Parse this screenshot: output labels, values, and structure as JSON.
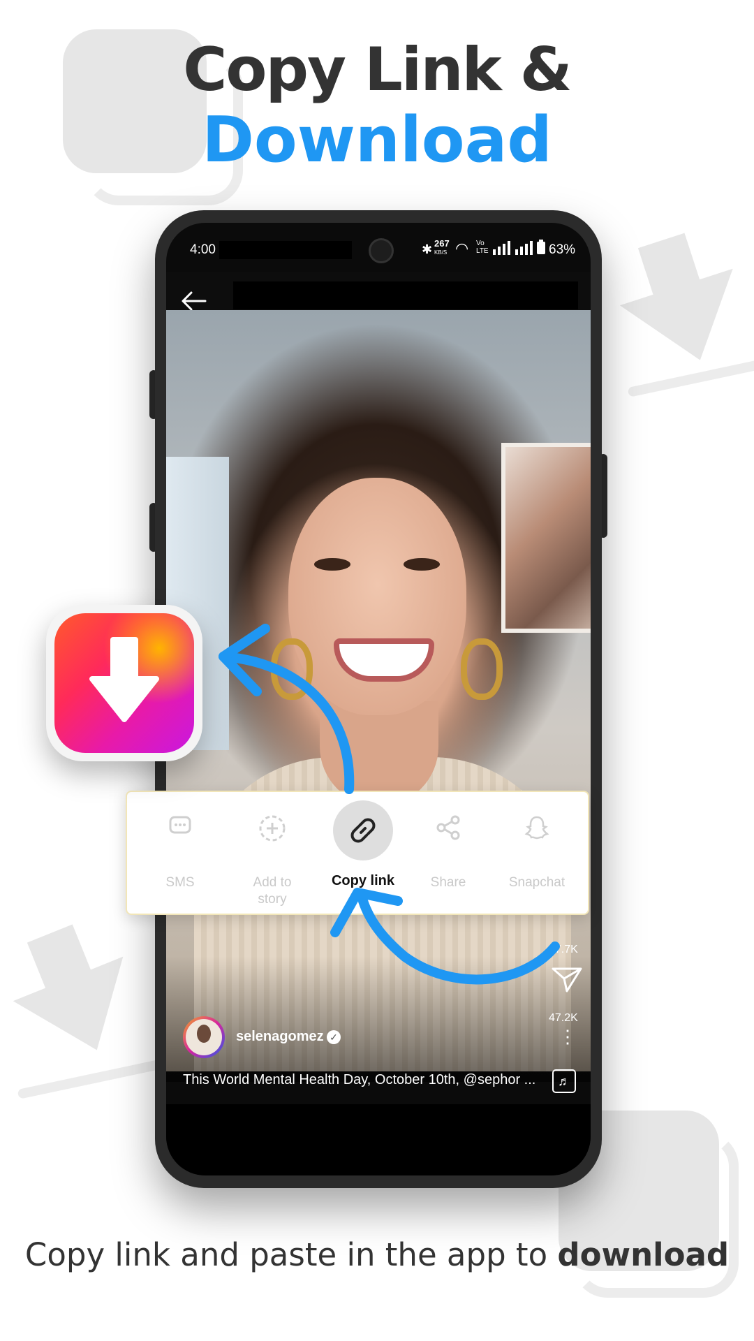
{
  "headline": {
    "line1": "Copy Link &",
    "line2": "Download"
  },
  "status_bar": {
    "time": "4:00",
    "net_speed": "267",
    "net_speed_unit": "KB/S",
    "battery": "63%"
  },
  "post": {
    "username": "selenagomez",
    "caption": "This World Mental Health Day, October 10th, @sephor ...",
    "likes_count": "27.7K",
    "shares_count": "47.2K"
  },
  "share_sheet": {
    "items": [
      {
        "label": "SMS",
        "icon": "sms-icon"
      },
      {
        "label": "Add to story",
        "icon": "add-story-icon"
      },
      {
        "label": "Copy link",
        "icon": "link-icon"
      },
      {
        "label": "Share",
        "icon": "share-icon"
      },
      {
        "label": "Snapchat",
        "icon": "snapchat-icon"
      }
    ]
  },
  "footer": {
    "text_plain": "Copy link and paste in the app to ",
    "text_bold": "download"
  },
  "colors": {
    "accent_blue": "#1f97f3",
    "heading_dark": "#333333"
  }
}
